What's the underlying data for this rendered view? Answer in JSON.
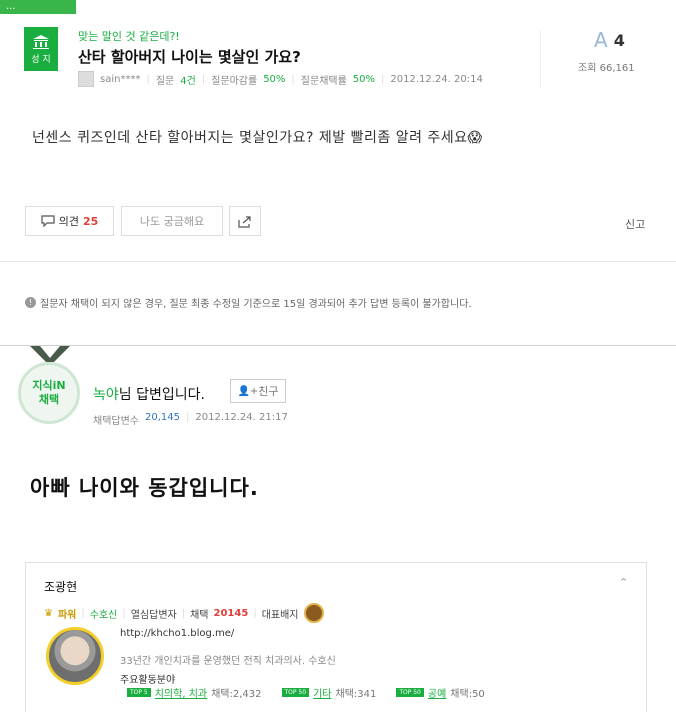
{
  "header": {
    "topbar_text": "...",
    "badge_label": "성 지",
    "subtitle": "맞는 말인 것 같은데?!",
    "title": "산타 할아버지 나이는 몇살인 가요?",
    "author": "sain****",
    "questions_label": "질문",
    "questions_value": "4건",
    "close_rate_label": "질문마감률",
    "close_rate_value": "50%",
    "adopt_rate_label": "질문채택률",
    "adopt_rate_value": "50%",
    "date": "2012.12.24. 20:14"
  },
  "stats": {
    "answer_letter": "A",
    "answer_count": "4",
    "views_label": "조회",
    "views_value": "66,161"
  },
  "question": {
    "body": "넌센스 퀴즈인데 산타 할아버지는 몇살인가요? 제발 빨리좀 알려 주세요😱"
  },
  "actions": {
    "opinion_label": "의견",
    "opinion_count": "25",
    "curious_label": "나도 궁금해요",
    "report_label": "신고"
  },
  "notice": {
    "text": "질문자 채택이 되지 않은 경우, 질문 최종 수정일 기준으로 15일 경과되어 추가 답변 등록이 불가합니다."
  },
  "answer": {
    "medal_line1": "지식iN",
    "medal_line2": "채택",
    "name": "녹야",
    "name_suffix": "님 답변입니다.",
    "friend_label": "친구",
    "adopt_count_label": "채택답변수",
    "adopt_count_value": "20,145",
    "date": "2012.12.24. 21:17",
    "body": "아빠 나이와 동갑입니다."
  },
  "profile": {
    "name": "조광현",
    "rank": "파워",
    "title": "수호신",
    "activity": "열심답변자",
    "adopt_label": "채택",
    "adopt_value": "20145",
    "badge_label": "대표배지",
    "url": "http://khcho1.blog.me/",
    "description": "33년간 개인치과를 운영했던 전직 치과의사. 수호신",
    "fields_label": "주요활동분야",
    "fields": [
      {
        "top": "TOP 5",
        "name": "치의학, 치과",
        "count": "채택:2,432"
      },
      {
        "top": "TOP 50",
        "name": "기타",
        "count": "채택:341"
      },
      {
        "top": "TOP 50",
        "name": "공예",
        "count": "채택:50"
      }
    ]
  }
}
